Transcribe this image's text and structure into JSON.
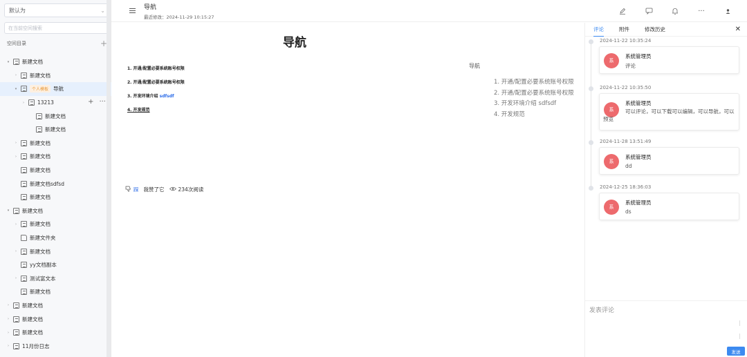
{
  "sidebar": {
    "space_selector": "默认为",
    "search_placeholder": "在当前空间搜索",
    "directory_label": "空间目录",
    "tree": [
      {
        "label": "新建文档",
        "depth": 0,
        "arrow": "▾",
        "icon": "doc"
      },
      {
        "label": "新建文档",
        "depth": 1,
        "arrow": "›",
        "icon": "doc"
      },
      {
        "label": "导航",
        "depth": 1,
        "arrow": "▾",
        "icon": "doc",
        "tag": "个人模板",
        "active": true
      },
      {
        "label": "13213",
        "depth": 2,
        "arrow": "›",
        "icon": "doc",
        "hover": true
      },
      {
        "label": "新建文档",
        "depth": 3,
        "arrow": "",
        "icon": "doc"
      },
      {
        "label": "新建文档",
        "depth": 3,
        "arrow": "",
        "icon": "doc"
      },
      {
        "label": "新建文档",
        "depth": 1,
        "arrow": "›",
        "icon": "doc"
      },
      {
        "label": "新建文档",
        "depth": 1,
        "arrow": "›",
        "icon": "doc"
      },
      {
        "label": "新建文档",
        "depth": 1,
        "arrow": "",
        "icon": "doc"
      },
      {
        "label": "新建文档sdfsd",
        "depth": 1,
        "arrow": "",
        "icon": "doc"
      },
      {
        "label": "新建文档",
        "depth": 1,
        "arrow": "",
        "icon": "doc"
      },
      {
        "label": "新建文档",
        "depth": 0,
        "arrow": "▾",
        "icon": "doc"
      },
      {
        "label": "新建文档",
        "depth": 1,
        "arrow": "›",
        "icon": "doc"
      },
      {
        "label": "新建文件夹",
        "depth": 1,
        "arrow": "",
        "icon": "folder"
      },
      {
        "label": "新建文档",
        "depth": 1,
        "arrow": "›",
        "icon": "doc"
      },
      {
        "label": "yy文档副本",
        "depth": 1,
        "arrow": "",
        "icon": "doc"
      },
      {
        "label": "测试富文本",
        "depth": 1,
        "arrow": "›",
        "icon": "doc"
      },
      {
        "label": "新建文档",
        "depth": 1,
        "arrow": "",
        "icon": "doc"
      },
      {
        "label": "新建文档",
        "depth": 0,
        "arrow": "›",
        "icon": "doc"
      },
      {
        "label": "新建文档",
        "depth": 0,
        "arrow": "›",
        "icon": "doc"
      },
      {
        "label": "新建文档",
        "depth": 0,
        "arrow": "›",
        "icon": "doc"
      },
      {
        "label": "11月份日志",
        "depth": 0,
        "arrow": "›",
        "icon": "doc"
      }
    ]
  },
  "header": {
    "title": "导航",
    "last_modified": "最近修改：2024-11-29 10:15:27"
  },
  "document": {
    "heading": "导航",
    "items": [
      {
        "text": "1. 开通/配置必要系统账号权限",
        "link": "",
        "underline": false
      },
      {
        "text": "2. 开通/配置必要系统账号权限",
        "link": "",
        "underline": false
      },
      {
        "text": "3. 开发环境介绍 ",
        "link": "sdfsdf",
        "underline": false
      },
      {
        "text": "4. 开发规范",
        "link": "",
        "underline": true
      }
    ],
    "like_prefix": "踩",
    "like_text": "我赞了它",
    "read_count": "234次阅读"
  },
  "toc": {
    "title": "导航",
    "items": [
      "1. 开通/配置必要系统账号权限",
      "2. 开通/配置必要系统账号权限",
      "3. 开发环境介绍 sdfsdf",
      "4. 开发规范"
    ]
  },
  "panel": {
    "tabs": [
      "评论",
      "附件",
      "修改历史"
    ],
    "comments": [
      {
        "time": "2024-11-22 10:35:24",
        "author": "系统管理员",
        "avatar": "系",
        "text": "评论"
      },
      {
        "time": "2024-11-22 10:35:50",
        "author": "系统管理员",
        "avatar": "系",
        "text": "可以评论，可以下载可以编辑，可以导航，可以预览"
      },
      {
        "time": "2024-11-28 13:51:49",
        "author": "系统管理员",
        "avatar": "系",
        "text": "dd"
      },
      {
        "time": "2024-12-25 18:36:03",
        "author": "系统管理员",
        "avatar": "系",
        "text": "ds"
      }
    ],
    "composer_placeholder": "发表评论",
    "send_label": "发送"
  },
  "colors": {
    "accent": "#3c8af0",
    "avatar": "#ed6a6d",
    "tag_bg": "#fdf0e1",
    "tag_text": "#e89a3c"
  }
}
